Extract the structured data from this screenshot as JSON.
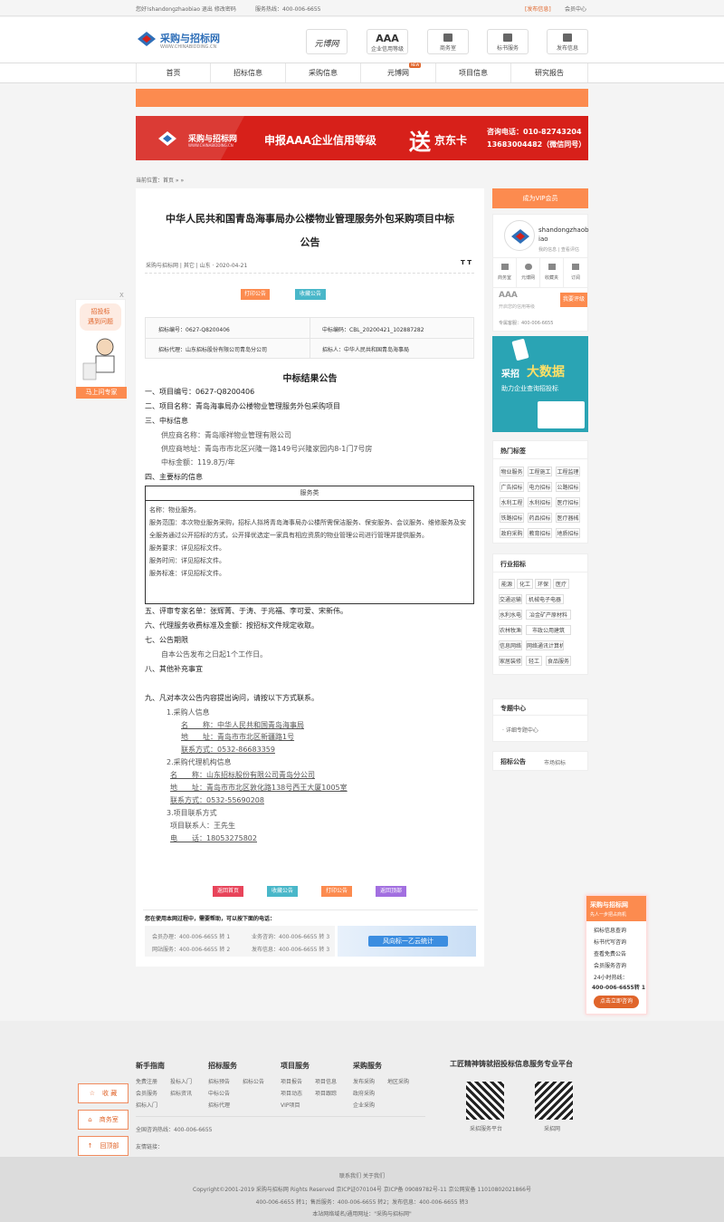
{
  "topbar": {
    "welcome": "您好!shandongzhaobiao 退出 修改密码",
    "hotline_label": "服务热线：400-006-6655",
    "publish": "[发布信息]",
    "user_center": "会员中心"
  },
  "logo": {
    "title": "采购与招标网",
    "sub": "WWW.CHINABIDDING.CN"
  },
  "header_icons": [
    {
      "label": "元博网"
    },
    {
      "label": "AAA",
      "sub": "企业信用等级"
    },
    {
      "label": "商务室"
    },
    {
      "label": "标书服务"
    },
    {
      "label": "发布信息"
    }
  ],
  "nav": [
    "首页",
    "招标信息",
    "采购信息",
    "元博网",
    "项目信息",
    "研究报告"
  ],
  "nav_badge": "NEW",
  "banner": {
    "logo": "采购与招标网",
    "logo_sub": "WWW.CHINABIDDING.CN",
    "main": "申报AAA企业信用等级",
    "gift_big": "送",
    "gift": "京东卡",
    "phone1": "咨询电话：010-82743204",
    "phone2": "13683004482（微信同号）"
  },
  "breadcrumb": "当前位置：首页 » »",
  "article": {
    "title_line1": "中华人民共和国青岛海事局办公楼物业管理服务外包采购项目中标",
    "title_line2": "公告",
    "meta": "采购与招标网 | 其它 | 山东 · 2020-04-21",
    "font_toggle": "T T",
    "tag1": "打印公告",
    "tag2": "收藏公告",
    "info_code": "招标编号：0627-Q8200406",
    "info_id": "中标编码：CBL_20200421_102887282",
    "info_agent": "招标代理：山东招标股份有限公司青岛分公司",
    "info_owner": "招标人：中华人民共和国青岛海事局",
    "heading": "中标结果公告",
    "l1": "一、项目编号：0627-Q8200406",
    "l2": "二、项目名称：青岛海事局办公楼物业管理服务外包采购项目",
    "l3": "三、中标信息",
    "l3a": "供应商名称：青岛顺祥物业管理有限公司",
    "l3b": "供应商地址：青岛市市北区兴隆一路149号兴隆家园内8-1门7号房",
    "l3c": "中标金额：119.8万/年",
    "l4": "四、主要标的信息",
    "box_head": "服务类",
    "box1": "名称：物业服务。",
    "box2": "服务范围：本次物业服务采购，招标人拟将青岛海事局办公楼所需保洁服务、保安服务、会议服务、维修服务及安全服务通过公开招标的方式，公开择优选定一家具有相应资质的物业管理公司进行管理并提供服务。",
    "box3": "服务要求：详见招标文件。",
    "box4": "服务时间：详见招标文件。",
    "box5": "服务标准：详见招标文件。",
    "l5": "五、评审专家名单：张辉菁、于涛、于兆福、李可爱、宋新伟。",
    "l6": "六、代理服务收费标准及金额：按招标文件规定收取。",
    "l7": "七、公告期限",
    "l7a": "自本公告发布之日起1个工作日。",
    "l8": "八、其他补充事宜",
    "l9": "九、凡对本次公告内容提出询问，请按以下方式联系。",
    "c1": "1.采购人信息",
    "c1n": "名　　称：中华人民共和国青岛海事局",
    "c1a": "地　　址：青岛市市北区新疆路1号",
    "c1t": "联系方式：0532-86683359",
    "c2": "2.采购代理机构信息",
    "c2n": "名　　称：山东招标股份有限公司青岛分公司",
    "c2a": "地　　址：青岛市市北区敦化路138号西王大厦1005室",
    "c2t": "联系方式：0532-55690208",
    "c3": "3.项目联系方式",
    "c3p": "项目联系人：王先生",
    "c3t": "电　　话：18053275802",
    "btn1": "返回首页",
    "btn2": "收藏公告",
    "btn3": "打印公告",
    "btn4": "返回顶部",
    "help": "您在使用本网过程中，需要帮助，可以按下面的电话：",
    "h1": "会员办理：400-006-6655 转 1",
    "h2": "业务咨询：400-006-6655 转 3",
    "h3": "网站服务：400-006-6655 转 2",
    "h4": "发布信息：400-006-6655 转 3",
    "ad": "风向标一乙云统计"
  },
  "sidebar": {
    "vip": "成为VIP会员",
    "user": "shandongzhaobiao",
    "user_links": "我的信息 | 查看评估",
    "icons": [
      "商务室",
      "元博网",
      "收藏夹",
      "订阅"
    ],
    "aaa": "AAA",
    "aaa_sub": "开启您的信用等级",
    "aaa_btn": "我要评级",
    "hotline": "专属客服：400-006-6655",
    "bigdata_a": "采招",
    "bigdata_b": "大数据",
    "bigdata_c": "助力企业查询招投标",
    "hot_title": "热门标签",
    "hot": [
      "物业服务",
      "工程施工",
      "工程监理",
      "广告招标",
      "电力招标",
      "公路招标",
      "水利工程",
      "水利招标",
      "医疗招标",
      "铁路招标",
      "药品招标",
      "医疗器械",
      "政府采购",
      "教育招标",
      "地质招标"
    ],
    "ind_title": "行业招标",
    "ind": [
      "能源",
      "化工",
      "环保",
      "医疗",
      "交通运输",
      "机械电子电器",
      "水利水电",
      "冶金矿产原材料",
      "农林牧渔",
      "市政公用建筑",
      "信息网络",
      "网络通讯计算机",
      "家居装修",
      "轻工",
      "食品服务"
    ],
    "topic_title": "专题中心",
    "topic": "· 详细专题中心",
    "notice_title": "招标公告",
    "notice": "市场招标"
  },
  "left_float": {
    "l1": "招投标",
    "l2": "遇到问题",
    "btn": "马上问专家",
    "close": "X"
  },
  "right_float": {
    "title": "采购与招标网",
    "sub": "先人一步把占商机",
    "items": [
      "招标信息查询",
      "标书代写咨询",
      "查看免费公告",
      "会员服务咨询",
      "24小时热线："
    ],
    "phone": "400-006-6655转 1",
    "btn": "点击立即咨询"
  },
  "footer": {
    "cols": [
      {
        "title": "新手指南",
        "items": [
          "免费注册",
          "会员服务",
          "招标入门"
        ]
      },
      {
        "title": "招标服务",
        "items": [
          "投标入门",
          "招标资讯",
          "招标预告",
          "中标公告",
          "招标公告",
          "招标代理"
        ]
      },
      {
        "title": "项目服务",
        "items": [
          "项目报告",
          "项目动态",
          "VIP项目",
          "项目信息",
          "项目跟踪"
        ]
      },
      {
        "title": "采购服务",
        "items": [
          "发布采购",
          "政府采购",
          "企业采购",
          "地区采购"
        ]
      }
    ],
    "platform": "工匠精神铸就招投标信息服务专业平台",
    "qr1": "采招服务平台",
    "qr2": "采招网",
    "service": "全国咨询热线：400-006-6655",
    "friend": "友情链接：",
    "float_btns": [
      "收 藏",
      "商务室",
      "回顶部"
    ],
    "about": "联系我们 关于我们",
    "copyright": "Copyright©2001-2019 采购与招标网 Rights Reserved 京ICP证070104号 京ICP备 09089782号-11 京公网安备 11010802021866号",
    "contacts": "400-006-6655 转1；售后服务：400-006-6655 转2；发布信息：400-006-6655 转3",
    "warning": "本站网络域名/通用网址：\"采购与招标网\""
  },
  "colors": {
    "accent": "#fc8b4f",
    "red": "#d7201a",
    "blue": "#2f6fb8",
    "teal": "#49b7c9"
  }
}
